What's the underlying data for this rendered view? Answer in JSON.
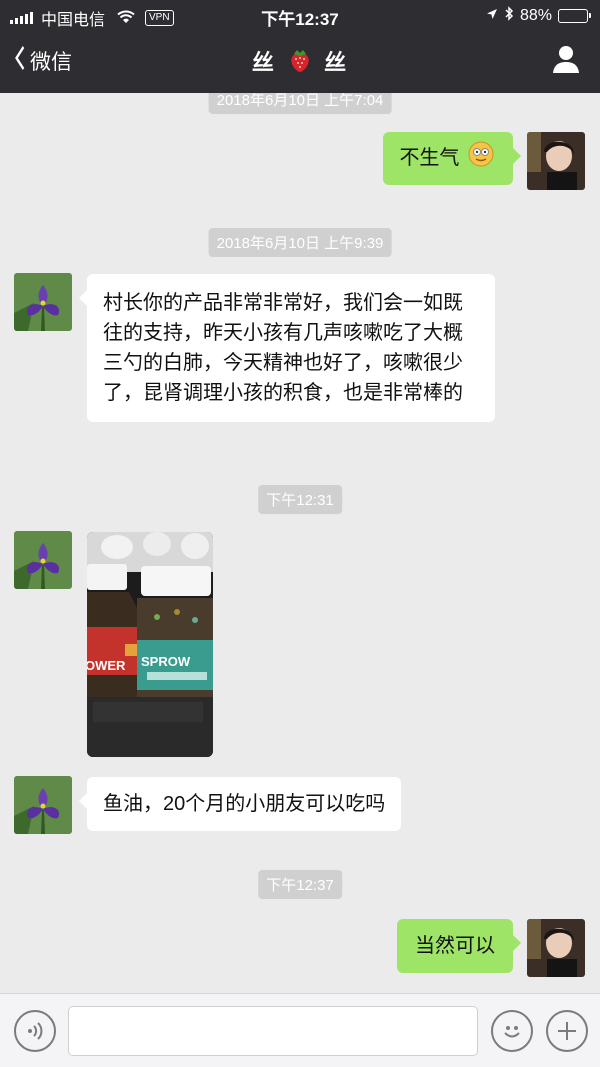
{
  "status_bar": {
    "carrier": "中国电信",
    "vpn": "VPN",
    "time": "下午12:37",
    "battery": "88%",
    "battery_level": 0.88
  },
  "nav": {
    "back_label": "微信",
    "title_left": "丝",
    "title_right": "丝"
  },
  "chat": {
    "partial_timestamp": "2018年6月10日 上午7:04",
    "messages": [
      {
        "text": "不生气"
      },
      {
        "timestamp": "2018年6月10日 上午9:39"
      },
      {
        "text": "村长你的产品非常非常好，我们会一如既往的支持，昨天小孩有几声咳嗽吃了大概三勺的白肺，今天精神也好了，咳嗽很少了，昆肾调理小孩的积食，也是非常棒的"
      },
      {
        "timestamp": "下午12:31"
      },
      {
        "photo_text_left": "OWER",
        "photo_text_right": "SPROW"
      },
      {
        "text": "鱼油，20个月的小朋友可以吃吗"
      },
      {
        "timestamp": "下午12:37"
      },
      {
        "text": "当然可以"
      }
    ]
  },
  "colors": {
    "nav_bg": "#2e2e32",
    "chat_bg": "#ebebeb",
    "outgoing_bubble": "#9de467",
    "incoming_bubble": "#ffffff",
    "timestamp_bg": "#d0d0d0"
  }
}
